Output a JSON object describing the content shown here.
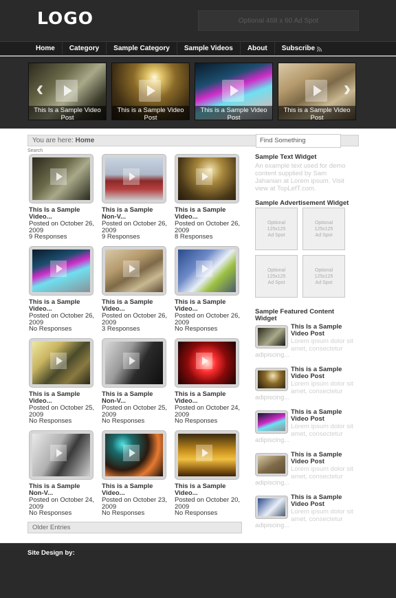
{
  "header": {
    "logo": "LOGO",
    "ad_spot": "Optional 468 x 60 Ad Spot"
  },
  "nav": {
    "items": [
      "Home",
      "Category",
      "Sample Category",
      "Sample Videos",
      "About",
      "Subscribe"
    ]
  },
  "slider": {
    "slides": [
      {
        "caption": "This Is a Sample Video Post"
      },
      {
        "caption": "This is a Sample Video Post"
      },
      {
        "caption": "This is a Sample Video Post"
      },
      {
        "caption": "This is a Sample Video Post"
      }
    ],
    "prev_arrow": "‹",
    "next_arrow": "›"
  },
  "breadcrumb": {
    "prefix": "You are here:",
    "current": "Home"
  },
  "search": {
    "placeholder": "Find Something",
    "label": "Search"
  },
  "posts": [
    {
      "title1": "This Is a Sample",
      "title2": "Video...",
      "date1": "Posted on October 26,",
      "date2": "2009",
      "responses": "9 Responses"
    },
    {
      "title1": "This is a Sample",
      "title2": "Non-V...",
      "date1": "Posted on October 26,",
      "date2": "2009",
      "responses": "9 Responses"
    },
    {
      "title1": "This is a Sample",
      "title2": "Video...",
      "date1": "Posted on October 26,",
      "date2": "2009",
      "responses": "8 Responses"
    },
    {
      "title1": "This is a Sample",
      "title2": "Video...",
      "date1": "Posted on October 26,",
      "date2": "2009",
      "responses": "No Responses"
    },
    {
      "title1": "This is a Sample",
      "title2": "Video...",
      "date1": "Posted on October 26,",
      "date2": "2009",
      "responses": "3 Responses"
    },
    {
      "title1": "This is a Sample",
      "title2": "Video...",
      "date1": "Posted on October 26,",
      "date2": "2009",
      "responses": "No Responses"
    },
    {
      "title1": "This is a Sample",
      "title2": "Video...",
      "date1": "Posted on October 25,",
      "date2": "2009",
      "responses": "No Responses"
    },
    {
      "title1": "This is a Sample",
      "title2": "Non-V...",
      "date1": "Posted on October 25,",
      "date2": "2009",
      "responses": "No Responses"
    },
    {
      "title1": "This is a Sample",
      "title2": "Video...",
      "date1": "Posted on October 24,",
      "date2": "2009",
      "responses": "No Responses"
    },
    {
      "title1": "This is a Sample",
      "title2": "Non-V...",
      "date1": "Posted on October 24,",
      "date2": "2009",
      "responses": "No Responses"
    },
    {
      "title1": "This is a Sample",
      "title2": "Video...",
      "date1": "Posted on October 23,",
      "date2": "2009",
      "responses": "No Responses"
    },
    {
      "title1": "This is a Sample",
      "title2": "Video...",
      "date1": "Posted on October 20,",
      "date2": "2009",
      "responses": "No Responses"
    }
  ],
  "older_entries": "Older Entries",
  "sidebar": {
    "text_widget": {
      "title": "Sample Text Widget",
      "line1": "An example text used for demo",
      "line2": "content supplied by Sam",
      "line3": "Jahanian at Lorem ipsum. Visit",
      "line4": "view at TopLefT.com."
    },
    "ad_widget": {
      "title": "Sample Advertisement Widget",
      "ad_line1": "Optional",
      "ad_line2": "125x125",
      "ad_line3": "Ad Spot"
    },
    "featured_widget": {
      "title1": "Sample Featured Content",
      "title2": "Widget",
      "items": [
        {
          "title1": "This Is a Sample",
          "title2": "Video Post",
          "excerpt1": "Lorem ipsum dolor sit",
          "excerpt2": "amet, consectetur",
          "cont": "adipiscing..."
        },
        {
          "title1": "This is a Sample",
          "title2": "Video Post",
          "excerpt1": "Lorem ipsum dolor sit",
          "excerpt2": "amet, consectetur",
          "cont": "adipiscing..."
        },
        {
          "title1": "This is a Sample",
          "title2": "Video Post",
          "excerpt1": "Lorem ipsum dolor sit",
          "excerpt2": "amet, consectetur",
          "cont": "adipiscing..."
        },
        {
          "title1": "This is a Sample",
          "title2": "Video Post",
          "excerpt1": "Lorem ipsum dolor sit",
          "excerpt2": "amet, consectetur",
          "cont": "adipiscing..."
        },
        {
          "title1": "This is a Sample",
          "title2": "Video Post",
          "excerpt1": "Lorem ipsum dolor sit",
          "excerpt2": "amet, consectetur",
          "cont": "adipiscing..."
        }
      ]
    }
  },
  "footer": {
    "credit": "Site Design by:"
  },
  "colors": {
    "header_bg": "#2a2a2a",
    "nav_bg": "#1e1e1e",
    "slider_bg": "#2c2c2c",
    "footer_bg": "#2a2a2a"
  }
}
